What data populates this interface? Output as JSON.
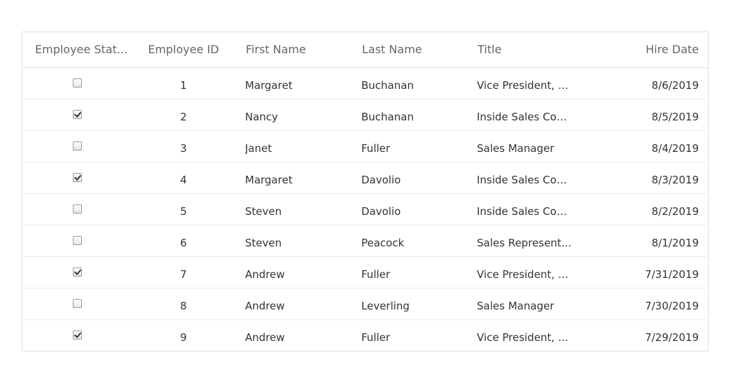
{
  "grid": {
    "columns": {
      "status": "Employee Stat...",
      "id": "Employee ID",
      "first_name": "First Name",
      "last_name": "Last Name",
      "title": "Title",
      "hire_date": "Hire Date"
    },
    "rows": [
      {
        "status": false,
        "id": "1",
        "first_name": "Margaret",
        "last_name": "Buchanan",
        "title": "Vice President, S...",
        "hire_date": "8/6/2019"
      },
      {
        "status": true,
        "id": "2",
        "first_name": "Nancy",
        "last_name": "Buchanan",
        "title": "Inside Sales Coo...",
        "hire_date": "8/5/2019"
      },
      {
        "status": false,
        "id": "3",
        "first_name": "Janet",
        "last_name": "Fuller",
        "title": "Sales Manager",
        "hire_date": "8/4/2019"
      },
      {
        "status": true,
        "id": "4",
        "first_name": "Margaret",
        "last_name": "Davolio",
        "title": "Inside Sales Coo...",
        "hire_date": "8/3/2019"
      },
      {
        "status": false,
        "id": "5",
        "first_name": "Steven",
        "last_name": "Davolio",
        "title": "Inside Sales Coo...",
        "hire_date": "8/2/2019"
      },
      {
        "status": false,
        "id": "6",
        "first_name": "Steven",
        "last_name": "Peacock",
        "title": "Sales Represent...",
        "hire_date": "8/1/2019"
      },
      {
        "status": true,
        "id": "7",
        "first_name": "Andrew",
        "last_name": "Fuller",
        "title": "Vice President, S...",
        "hire_date": "7/31/2019"
      },
      {
        "status": false,
        "id": "8",
        "first_name": "Andrew",
        "last_name": "Leverling",
        "title": "Sales Manager",
        "hire_date": "7/30/2019"
      },
      {
        "status": true,
        "id": "9",
        "first_name": "Andrew",
        "last_name": "Fuller",
        "title": "Vice President, S...",
        "hire_date": "7/29/2019"
      }
    ]
  }
}
